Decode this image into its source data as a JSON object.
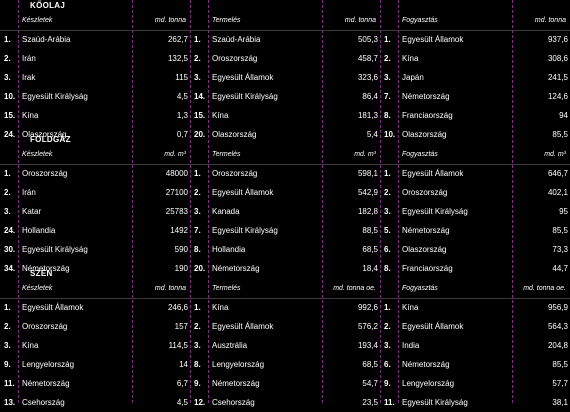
{
  "sections": [
    {
      "title": "KŐOLAJ",
      "panels": [
        {
          "header": {
            "name": "Készletek",
            "unit": "md. tonna"
          },
          "rows": [
            {
              "rank": "1.",
              "country": "Szaúd-Arábia",
              "value": "262,7"
            },
            {
              "rank": "2.",
              "country": "Irán",
              "value": "132,5"
            },
            {
              "rank": "3.",
              "country": "Irak",
              "value": "115"
            },
            {
              "rank": "10.",
              "country": "Egyesült Királyság",
              "value": "4,5"
            },
            {
              "rank": "15.",
              "country": "Kína",
              "value": "1,3"
            },
            {
              "rank": "24.",
              "country": "Olaszország",
              "value": "0,7"
            }
          ]
        },
        {
          "header": {
            "name": "Termelés",
            "unit": "md. tonna"
          },
          "rows": [
            {
              "rank": "1.",
              "country": "Szaúd-Arábia",
              "value": "505,3"
            },
            {
              "rank": "2.",
              "country": "Oroszország",
              "value": "458,7"
            },
            {
              "rank": "3.",
              "country": "Egyesült Államok",
              "value": "323,6"
            },
            {
              "rank": "14.",
              "country": "Egyesült Királyság",
              "value": "86,4"
            },
            {
              "rank": "15.",
              "country": "Kína",
              "value": "181,3"
            },
            {
              "rank": "20.",
              "country": "Olaszország",
              "value": "5,4"
            }
          ]
        },
        {
          "header": {
            "name": "Fogyasztás",
            "unit": "md. tonna"
          },
          "rows": [
            {
              "rank": "1.",
              "country": "Egyesült Államok",
              "value": "937,6"
            },
            {
              "rank": "2.",
              "country": "Kína",
              "value": "308,6"
            },
            {
              "rank": "3.",
              "country": "Japán",
              "value": "241,5"
            },
            {
              "rank": "7.",
              "country": "Németország",
              "value": "124,6"
            },
            {
              "rank": "8.",
              "country": "Franciaország",
              "value": "94"
            },
            {
              "rank": "10.",
              "country": "Olaszország",
              "value": "85,5"
            }
          ]
        }
      ]
    },
    {
      "title": "FÖLDGÁZ",
      "panels": [
        {
          "header": {
            "name": "Készletek",
            "unit": "md. m³"
          },
          "rows": [
            {
              "rank": "1.",
              "country": "Oroszország",
              "value": "48000"
            },
            {
              "rank": "2.",
              "country": "Irán",
              "value": "27100"
            },
            {
              "rank": "3.",
              "country": "Katar",
              "value": "25783"
            },
            {
              "rank": "24.",
              "country": "Hollandia",
              "value": "1492"
            },
            {
              "rank": "30.",
              "country": "Egyesült Királyság",
              "value": "590"
            },
            {
              "rank": "34.",
              "country": "Németország",
              "value": "190"
            }
          ]
        },
        {
          "header": {
            "name": "Termelés",
            "unit": "md. m³"
          },
          "rows": [
            {
              "rank": "1.",
              "country": "Oroszország",
              "value": "598,1"
            },
            {
              "rank": "2.",
              "country": "Egyesült Államok",
              "value": "542,9"
            },
            {
              "rank": "3.",
              "country": "Kanada",
              "value": "182,8"
            },
            {
              "rank": "7.",
              "country": "Egyesült Királyság",
              "value": "88,5"
            },
            {
              "rank": "8.",
              "country": "Hollandia",
              "value": "68,5"
            },
            {
              "rank": "20.",
              "country": "Németország",
              "value": "18,4"
            }
          ]
        },
        {
          "header": {
            "name": "Fogyasztás",
            "unit": "md. m³"
          },
          "rows": [
            {
              "rank": "1.",
              "country": "Egyesült Államok",
              "value": "646,7"
            },
            {
              "rank": "2.",
              "country": "Oroszország",
              "value": "402,1"
            },
            {
              "rank": "3.",
              "country": "Egyesült Királyság",
              "value": "95"
            },
            {
              "rank": "5.",
              "country": "Németország",
              "value": "85,5"
            },
            {
              "rank": "6.",
              "country": "Olaszország",
              "value": "73,3"
            },
            {
              "rank": "8.",
              "country": "Franciaország",
              "value": "44,7"
            }
          ]
        }
      ]
    },
    {
      "title": "SZÉN",
      "panels": [
        {
          "header": {
            "name": "Készletek",
            "unit": "md. tonna"
          },
          "rows": [
            {
              "rank": "1.",
              "country": "Egyesült Államok",
              "value": "246,6"
            },
            {
              "rank": "2.",
              "country": "Oroszország",
              "value": "157"
            },
            {
              "rank": "3.",
              "country": "Kína",
              "value": "114,5"
            },
            {
              "rank": "9.",
              "country": "Lengyelország",
              "value": "14"
            },
            {
              "rank": "11.",
              "country": "Németország",
              "value": "6,7"
            },
            {
              "rank": "13.",
              "country": "Csehország",
              "value": "4,5"
            }
          ]
        },
        {
          "header": {
            "name": "Termelés",
            "unit": "md. tonna oe."
          },
          "rows": [
            {
              "rank": "1.",
              "country": "Kína",
              "value": "992,6"
            },
            {
              "rank": "2.",
              "country": "Egyesült Államok",
              "value": "576,2"
            },
            {
              "rank": "3.",
              "country": "Ausztrália",
              "value": "193,4"
            },
            {
              "rank": "8.",
              "country": "Lengyelország",
              "value": "68,5"
            },
            {
              "rank": "9.",
              "country": "Németország",
              "value": "54,7"
            },
            {
              "rank": "12.",
              "country": "Csehország",
              "value": "23,5"
            }
          ]
        },
        {
          "header": {
            "name": "Fogyasztás",
            "unit": "md. tonna oe."
          },
          "rows": [
            {
              "rank": "1.",
              "country": "Kína",
              "value": "956,9"
            },
            {
              "rank": "2.",
              "country": "Egyesült Államok",
              "value": "564,3"
            },
            {
              "rank": "3.",
              "country": "India",
              "value": "204,8"
            },
            {
              "rank": "6.",
              "country": "Németország",
              "value": "85,5"
            },
            {
              "rank": "9.",
              "country": "Lengyelország",
              "value": "57,7"
            },
            {
              "rank": "11.",
              "country": "Egyesült Királyság",
              "value": "38,1"
            }
          ]
        }
      ]
    }
  ]
}
